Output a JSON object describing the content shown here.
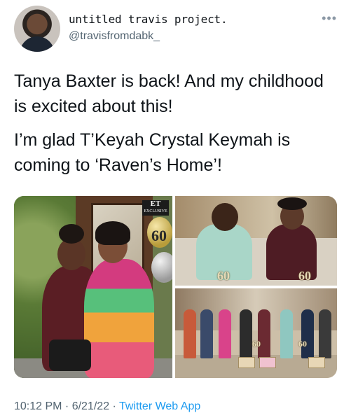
{
  "author": {
    "display_name": "untitled travis project.",
    "handle": "@travisfromdabk_",
    "avatar_icon": "profile-avatar"
  },
  "tweet": {
    "paragraphs": [
      "Tanya Baxter is back! And my childhood is excited about this!",
      "I’m glad T’Keyah Crystal Keymah is coming to ‘Raven’s Home’!"
    ]
  },
  "media": {
    "photo_overlay_left": {
      "logo": "ET",
      "logo_sub": "EXCLUSIVE",
      "balloon": "60"
    },
    "photo_overlay_top_right": {
      "balloon_left": "60",
      "balloon_right": "60"
    },
    "photo_overlay_bottom_right": {
      "balloon_left": "60",
      "balloon_right": "60"
    }
  },
  "meta": {
    "time": "10:12 PM",
    "separator": " · ",
    "date": "6/21/22",
    "app_label": "Twitter Web App"
  },
  "colors": {
    "text": "#0f1419",
    "secondary": "#536471",
    "link": "#1d9bf0"
  }
}
